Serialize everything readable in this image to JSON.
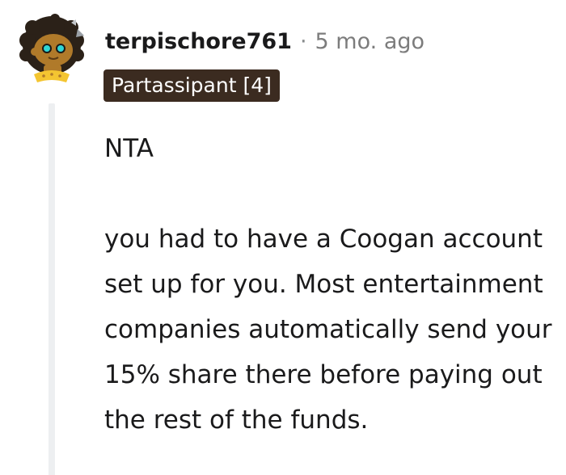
{
  "comment": {
    "author": "terpischore761",
    "separator": "·",
    "timestamp": "5 mo. ago",
    "flair": "Partassipant [4]",
    "avatar_icon": "snoo-avatar-icon",
    "paragraphs": [
      "NTA",
      "you had to have a Coogan account set up for you. Most entertainment companies automatically send your 15% share there before paying out the rest of the funds."
    ]
  },
  "colors": {
    "flair_background": "#3b2b20",
    "flair_text": "#ffffff",
    "meta_text": "#7c7c7c",
    "thread_line": "#edeff1",
    "avatar_skin": "#b07a2a",
    "avatar_hair": "#2b2118",
    "avatar_eyes": "#2fd6d6",
    "avatar_collar": "#f4c531"
  }
}
